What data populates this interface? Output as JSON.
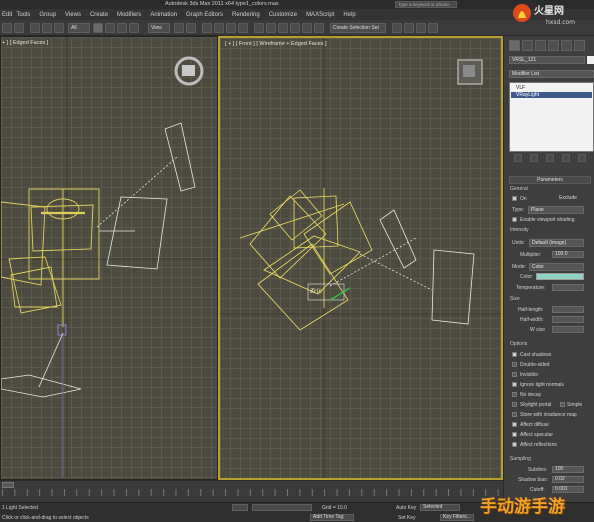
{
  "title_bar": {
    "title": "Autodesk 3ds Max 2011 x64     type1_colors.max",
    "search_placeholder": "Type a keyword or phrase"
  },
  "menu": [
    "Edit",
    "Tools",
    "Group",
    "Views",
    "Create",
    "Modifiers",
    "Animation",
    "Graph Editors",
    "Rendering",
    "Customize",
    "MAXScript",
    "Help"
  ],
  "toolbar": {
    "selection_filter": "All",
    "reference_coord": "View",
    "named_selection": "Create Selection Set"
  },
  "viewports": {
    "left_label": "+ ] [ Edged Faces ]",
    "front_label": "[ + ] [ Front ] [ Wireframe + Edged Faces ]"
  },
  "command_panel": {
    "object_name": "VRSL_121",
    "modifier_list": "Modifier List",
    "stack": [
      "VLF",
      "VRayLight"
    ],
    "parameters_title": "Parameters",
    "general": {
      "section": "General",
      "on_label": "On",
      "exclude_label": "Exclude",
      "type_label": "Type:",
      "type_value": "Plane",
      "viewport_shading": "Enable viewport shading"
    },
    "intensity": {
      "section": "Intensity",
      "units_label": "Units:",
      "units_value": "Default (image)",
      "multiplier_label": "Multiplier:",
      "multiplier_value": "100.0",
      "mode_label": "Mode:",
      "mode_value": "Color",
      "color_label": "Color:",
      "color_swatch": "#8fd4c4",
      "temperature_label": "Temperature:"
    },
    "size": {
      "section": "Size",
      "half_length_label": "Half-length:",
      "half_width_label": "Half-width:",
      "w_size_label": "W size"
    },
    "options": {
      "section": "Options",
      "items": [
        {
          "label": "Cast shadows",
          "checked": true
        },
        {
          "label": "Double-sided",
          "checked": false
        },
        {
          "label": "Invisible",
          "checked": false
        },
        {
          "label": "Ignore light normals",
          "checked": true
        },
        {
          "label": "No decay",
          "checked": false
        },
        {
          "label": "Skylight portal",
          "checked": false
        },
        {
          "label": "Store with irradiance map",
          "checked": false
        },
        {
          "label": "Affect diffuse",
          "checked": true
        },
        {
          "label": "Affect specular",
          "checked": true
        },
        {
          "label": "Affect reflections",
          "checked": true
        }
      ],
      "simple_label": "Simple"
    },
    "sampling": {
      "section": "Sampling",
      "subdivs_label": "Subdivs:",
      "subdivs_value": "100",
      "shadow_bias_label": "Shadow bias:",
      "shadow_bias_value": "0.02",
      "cutoff_label": "Cutoff:",
      "cutoff_value": "0.001"
    }
  },
  "status": {
    "selected": "1 Light Selected",
    "prompt": "Click or click-and-drag to select objects",
    "grid": "Grid = 10.0",
    "add_time_tag": "Add Time Tag",
    "auto_key": "Auto Key",
    "selected_dropdown": "Selected",
    "set_key": "Set Key",
    "key_filters": "Key Filters..."
  },
  "watermark": "手动游手游",
  "logo": {
    "brand": "火星网",
    "sub": "hxsd.com"
  },
  "accent_color": "#b8a030"
}
